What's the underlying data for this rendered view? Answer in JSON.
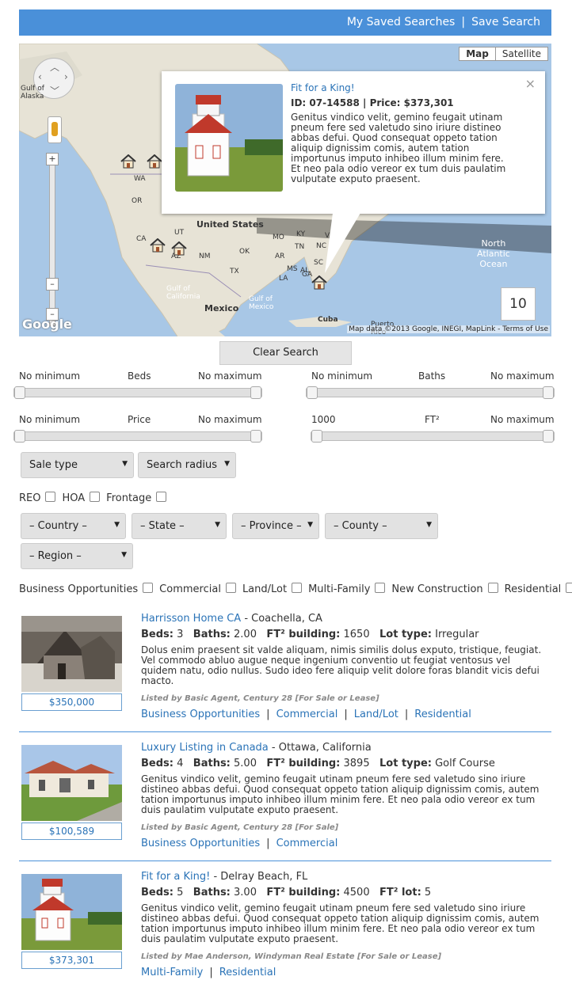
{
  "topbar": {
    "my_saved_searches": "My Saved Searches",
    "separator": "|",
    "save_search": "Save Search"
  },
  "map": {
    "type_map": "Map",
    "type_satellite": "Satellite",
    "labels": {
      "gulf_alaska": "Gulf of\nAlaska",
      "united_states": "United States",
      "mexico": "Mexico",
      "cuba": "Cuba",
      "north_atlantic": "North\nAtlantic\nOcean",
      "gulf_california": "Gulf of\nCalifornia",
      "gulf_mexico": "Gulf of\nMexico",
      "puerto_rico": "Puerto\nRico",
      "wa": "WA",
      "or": "OR",
      "ca": "CA",
      "ut": "UT",
      "az": "AZ",
      "nm": "NM",
      "tx": "TX",
      "ok": "OK",
      "ms": "MS",
      "al": "AL",
      "ga": "GA",
      "sc": "SC",
      "nc": "NC",
      "tn": "TN",
      "ar": "AR",
      "ky": "KY",
      "la": "LA",
      "mo": "MO",
      "va": "VA"
    },
    "count": "10",
    "google": "Google",
    "attribution": "Map data ©2013 Google, INEGI, MapLink - Terms of Use"
  },
  "popup": {
    "title": "Fit for a King!",
    "id_label": "ID: 07-14588",
    "price_label": "Price: $373,301",
    "description": "Genitus vindico velit, gemino feugait utinam pneum fere sed valetudo sino iriure distineo abbas defui. Quod consequat oppeto tation aliquip dignissim comis, autem tation importunus imputo inhibeo illum minim fere. Et neo pala odio vereor ex tum duis paulatim vulputate exputo praesent.",
    "close": "×"
  },
  "clear_search": "Clear Search",
  "filters": {
    "beds": {
      "min": "No minimum",
      "label": "Beds",
      "max": "No maximum"
    },
    "baths": {
      "min": "No minimum",
      "label": "Baths",
      "max": "No maximum"
    },
    "price": {
      "min": "No minimum",
      "label": "Price",
      "max": "No maximum"
    },
    "ft2": {
      "min": "1000",
      "label": "FT²",
      "max": "No maximum"
    }
  },
  "selects": {
    "sale_type": "Sale type",
    "search_radius": "Search radius",
    "country": "– Country –",
    "state": "– State –",
    "province": "– Province –",
    "county": "– County –",
    "region": "– Region –"
  },
  "checks1": [
    "REO",
    "HOA",
    "Frontage"
  ],
  "checks2": [
    "Business Opportunities",
    "Commercial",
    "Land/Lot",
    "Multi-Family",
    "New Construction",
    "Residential"
  ],
  "listings": [
    {
      "title": "Harrisson Home CA",
      "location": " - Coachella, CA",
      "beds_label": "Beds:",
      "beds": "3",
      "baths_label": "Baths:",
      "baths": "2.00",
      "building_label": "FT² building:",
      "building": "1650",
      "extra_label": "Lot type:",
      "extra": "Irregular",
      "description": "Dolus enim praesent sit valde aliquam, nimis similis dolus exputo, tristique, feugiat. Vel commodo abluo augue neque ingenium conventio ut feugiat ventosus vel quidem natu, odio nullus. Sudo ideo fere aliquip velit dolore foras blandit vicis defui macto.",
      "price": "$350,000",
      "lister": "Listed by Basic Agent, Century 28 [For Sale or Lease]",
      "tags": [
        "Business Opportunities",
        "Commercial",
        "Land/Lot",
        "Residential"
      ]
    },
    {
      "title": "Luxury Listing in Canada",
      "location": " - Ottawa, California",
      "beds_label": "Beds:",
      "beds": "4",
      "baths_label": "Baths:",
      "baths": "5.00",
      "building_label": "FT² building:",
      "building": "3895",
      "extra_label": "Lot type:",
      "extra": "Golf Course",
      "description": "Genitus vindico velit, gemino feugait utinam pneum fere sed valetudo sino iriure distineo abbas defui. Quod consequat oppeto tation aliquip dignissim comis, autem tation importunus imputo inhibeo illum minim fere. Et neo pala odio vereor ex tum duis paulatim vulputate exputo praesent.",
      "price": "$100,589",
      "lister": "Listed by Basic Agent, Century 28 [For Sale]",
      "tags": [
        "Business Opportunities",
        "Commercial"
      ]
    },
    {
      "title": "Fit for a King!",
      "location": " - Delray Beach, FL",
      "beds_label": "Beds:",
      "beds": "5",
      "baths_label": "Baths:",
      "baths": "3.00",
      "building_label": "FT² building:",
      "building": "4500",
      "extra_label": "FT² lot:",
      "extra": "5",
      "description": "Genitus vindico velit, gemino feugait utinam pneum fere sed valetudo sino iriure distineo abbas defui. Quod consequat oppeto tation aliquip dignissim comis, autem tation importunus imputo inhibeo illum minim fere. Et neo pala odio vereor ex tum duis paulatim vulputate exputo praesent.",
      "price": "$373,301",
      "lister": "Listed by Mae Anderson, Windyman Real Estate [For Sale or Lease]",
      "tags": [
        "Multi-Family",
        "Residential"
      ]
    }
  ]
}
